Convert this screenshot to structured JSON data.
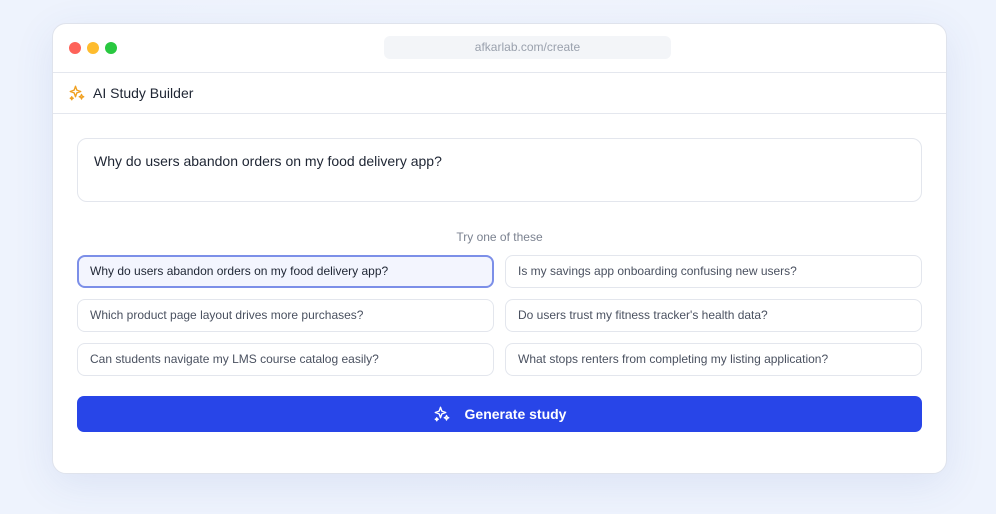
{
  "browser": {
    "url": "afkarlab.com/create"
  },
  "app": {
    "title": "AI Study Builder",
    "icon": "sparkles-icon",
    "accent_color": "#f0a020"
  },
  "prompt": {
    "value": "Why do users abandon orders on my food delivery app?"
  },
  "suggestions": {
    "hint": "Try one of these",
    "items": [
      "Why do users abandon orders on my food delivery app?",
      "Is my savings app onboarding confusing new users?",
      "Which product page layout drives more purchases?",
      "Do users trust my fitness tracker's health data?",
      "Can students navigate my LMS course catalog easily?",
      "What stops renters from completing my listing application?"
    ],
    "selected_index": 0
  },
  "generate": {
    "label": "Generate study",
    "color": "#2845e8"
  }
}
